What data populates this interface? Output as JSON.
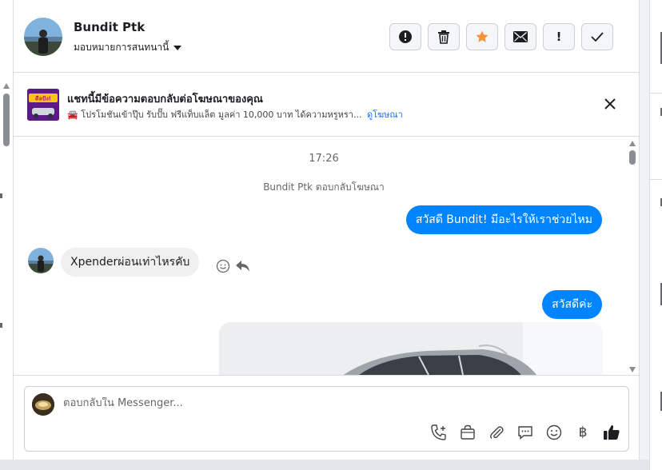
{
  "header": {
    "contact_name": "Bundit Ptk",
    "assign_label": "มอบหมายการสนทนานี้",
    "actions": [
      {
        "name": "spam-icon"
      },
      {
        "name": "trash-icon"
      },
      {
        "name": "star-icon"
      },
      {
        "name": "mail-icon"
      },
      {
        "name": "follow-up-icon",
        "label": "!"
      },
      {
        "name": "done-icon"
      }
    ],
    "star_color": "#f7923a"
  },
  "ad_banner": {
    "title": "แชทนี้มีข้อความตอบกลับต่อโฆษณาของคุณ",
    "description": "🚘 โปรโมชันเข้าปุ๊บ รับปั๊บ ฟรีแท็บแล็ต มูลค่า 10,000 บาท ได้ความหรูหรา...",
    "link_label": "ดูโฆษณา",
    "thumb_text": "ดีลปัง!"
  },
  "chat": {
    "time": "17:26",
    "system_note": "Bundit Ptk ตอบกลับโฆษณา",
    "outgoing_1": "สวัสดี Bundit! มีอะไรให้เราช่วยไหม",
    "incoming_1": "Xpenderผ่อนเท่าไหรคับ",
    "outgoing_2": "สวัสดีค่ะ",
    "accent": "#0084ff"
  },
  "composer": {
    "placeholder": "ตอบกลับใน Messenger...",
    "tools": [
      "phone-plus-icon",
      "bag-icon",
      "paperclip-icon",
      "speech-bubble-icon",
      "emoji-icon",
      "baht-icon",
      "thumbs-up-icon"
    ],
    "baht_symbol": "฿"
  }
}
